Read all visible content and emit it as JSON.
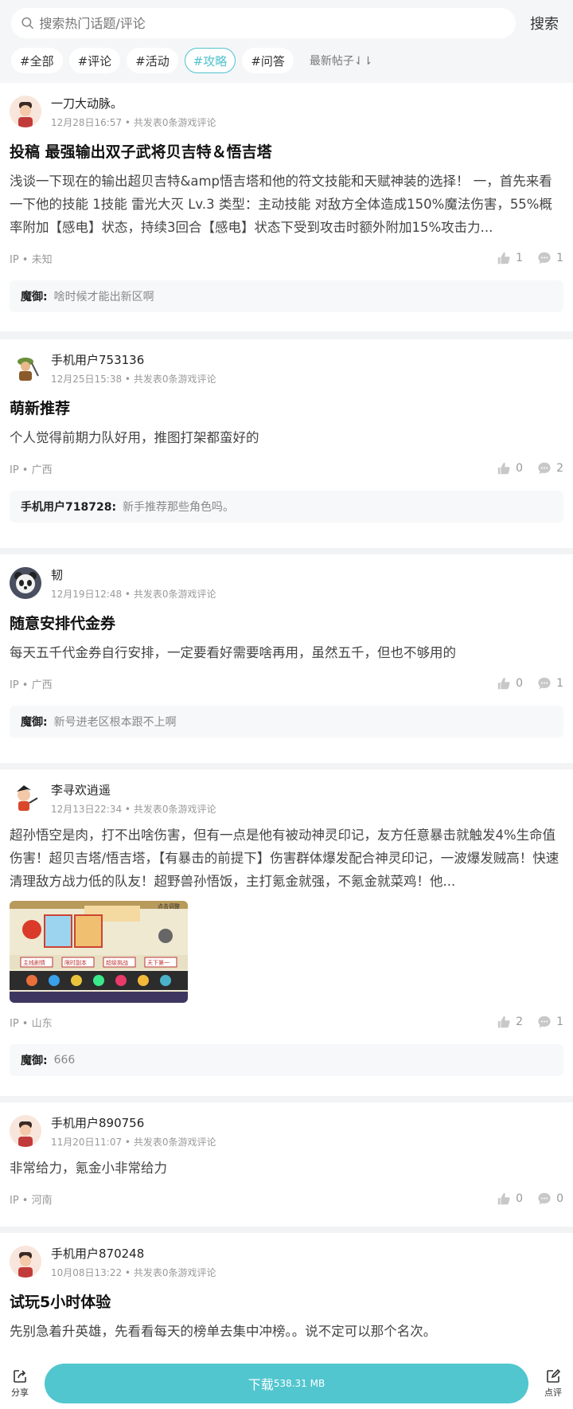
{
  "search": {
    "placeholder": "搜索热门话题/评论",
    "button": "搜索"
  },
  "tags": [
    "#全部",
    "#评论",
    "#活动",
    "#攻略",
    "#问答"
  ],
  "active_tag_index": 3,
  "sort_label": "最新帖子⇃⇂",
  "posts": [
    {
      "author": "一刀大动脉。",
      "meta": "12月28日16:57 • 共发表0条游戏评论",
      "title": "投稿 最强输出双子武将贝吉特＆悟吉塔",
      "content": "浅谈一下现在的输出超贝吉特&amp悟吉塔和他的符文技能和天赋神装的选择！ 一，首先来看一下他的技能 1技能 雷光大灭 Lv.3 类型：主动技能 对敌方全体造成150%魔法伤害，55%概率附加【感电】状态，持续3回合【感电】状态下受到攻击时额外附加15%攻击力...",
      "ip": "IP • 未知",
      "likes": "1",
      "comments": "1",
      "reply_name": "魔御:",
      "reply_text": "啥时候才能出新区啊"
    },
    {
      "author": "手机用户753136",
      "meta": "12月25日15:38 • 共发表0条游戏评论",
      "title": "萌新推荐",
      "content": "个人觉得前期力队好用，推图打架都蛮好的",
      "ip": "IP • 广西",
      "likes": "0",
      "comments": "2",
      "reply_name": "手机用户718728:",
      "reply_text": "新手推荐那些角色吗。"
    },
    {
      "author": "韧",
      "meta": "12月19日12:48 • 共发表0条游戏评论",
      "title": "随意安排代金券",
      "content": "每天五千代金券自行安排，一定要看好需要啥再用，虽然五千，但也不够用的",
      "ip": "IP • 广西",
      "likes": "0",
      "comments": "1",
      "reply_name": "魔御:",
      "reply_text": "新号进老区根本跟不上啊"
    },
    {
      "author": "李寻欢逍遥",
      "meta": "12月13日22:34 • 共发表0条游戏评论",
      "title": "",
      "content": "超孙悟空是肉，打不出啥伤害，但有一点是他有被动神灵印记，友方任意暴击就触发4%生命值伤害！超贝吉塔/悟吉塔，【有暴击的前提下】伤害群体爆发配合神灵印记，一波爆发贼高！快速清理敌方战力低的队友！超野兽孙悟饭，主打氪金就强，不氪金就菜鸡！他...",
      "ip": "IP • 山东",
      "likes": "2",
      "comments": "1",
      "reply_name": "魔御:",
      "reply_text": "666"
    },
    {
      "author": "手机用户890756",
      "meta": "11月20日11:07 • 共发表0条游戏评论",
      "title": "",
      "content": "非常给力，氪金小非常给力",
      "ip": "IP • 河南",
      "likes": "0",
      "comments": "0"
    },
    {
      "author": "手机用户870248",
      "meta": "10月08日13:22 • 共发表0条游戏评论",
      "title": "试玩5小时体验",
      "content": "先别急着升英雄，先看看每天的榜单去集中冲榜。。说不定可以那个名次。"
    }
  ],
  "post4_image_labels": {
    "corner": "点击调整",
    "tab1": "主线剧情",
    "tab2": "限时副本",
    "tab3": "超级挑战",
    "tab4": "天下第一"
  },
  "bottom": {
    "share": "分享",
    "download": "下载",
    "size": "538.31 MB",
    "review": "点评"
  },
  "colors": {
    "accent": "#52c6cf",
    "active_tag": "#4ec2cc"
  }
}
